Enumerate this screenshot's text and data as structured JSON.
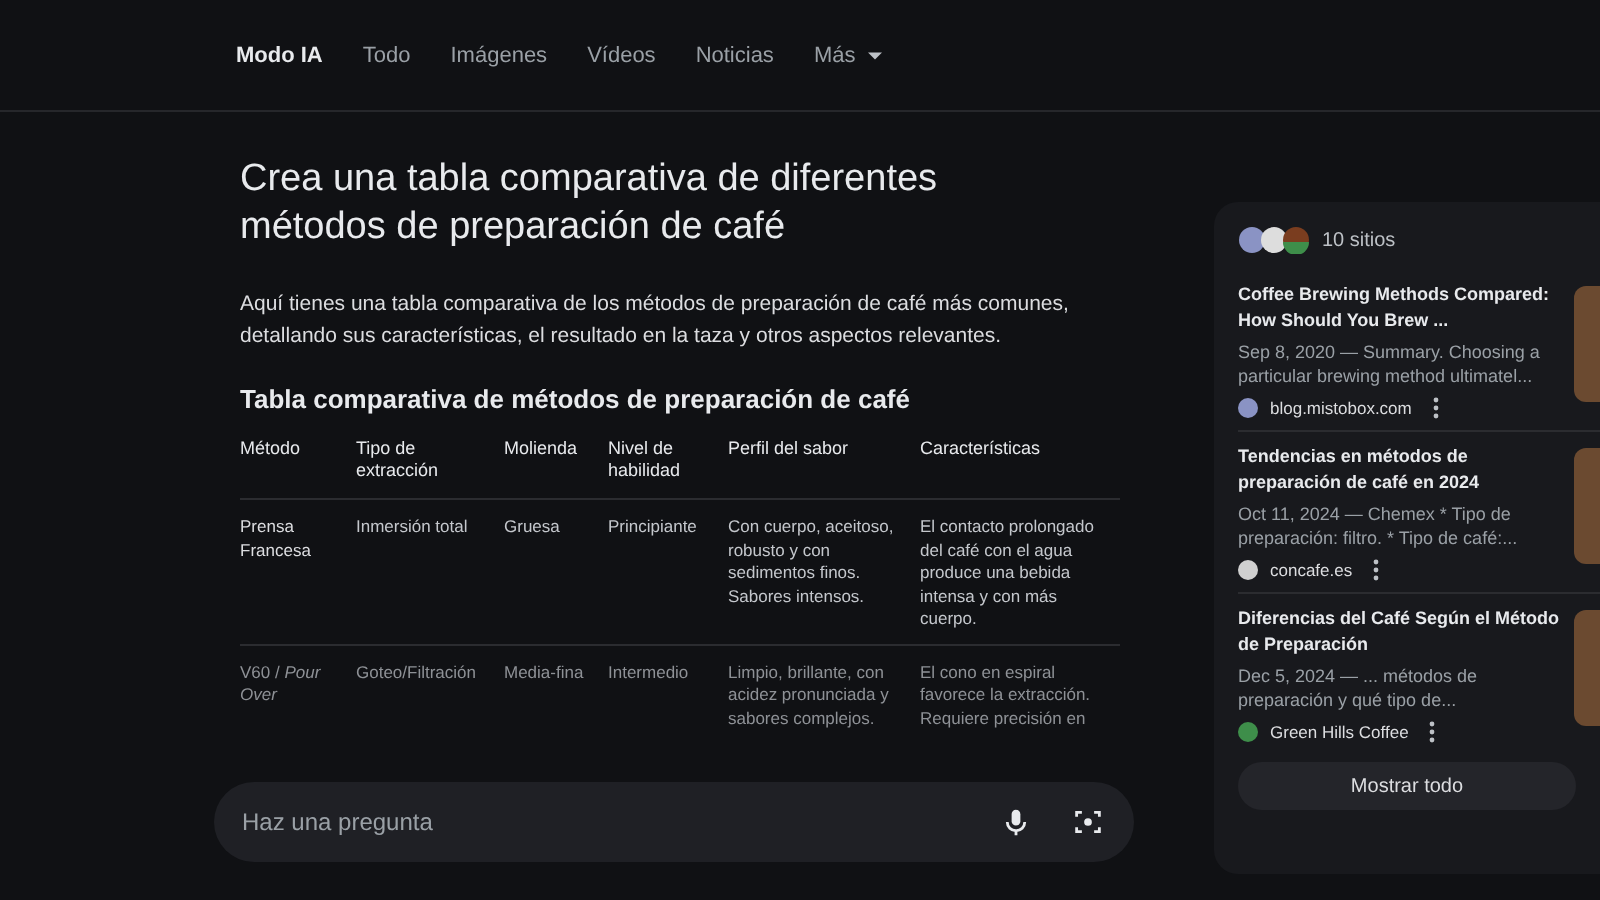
{
  "nav": {
    "tabs": [
      {
        "label": "Modo IA",
        "selected": true
      },
      {
        "label": "Todo",
        "selected": false
      },
      {
        "label": "Imágenes",
        "selected": false
      },
      {
        "label": "Vídeos",
        "selected": false
      },
      {
        "label": "Noticias",
        "selected": false
      },
      {
        "label": "Más",
        "selected": false,
        "kind": "dropdown"
      }
    ]
  },
  "answer": {
    "title": "Crea una tabla comparativa de diferentes métodos de preparación de café",
    "intro": "Aquí tienes una tabla comparativa de los métodos de preparación de café más comunes, detallando sus características, el resultado en la taza y otros aspectos relevantes.",
    "table_title": "Tabla comparativa de métodos de preparación de café",
    "table": {
      "columns": [
        "Método",
        "Tipo de extracción",
        "Molienda",
        "Nivel de habilidad",
        "Perfil del sabor",
        "Características"
      ],
      "rows": [
        [
          "Prensa Francesa",
          "Inmersión total",
          "Gruesa",
          "Principiante",
          "Con cuerpo, aceitoso, robusto y con sedimentos finos. Sabores intensos.",
          "El contacto prolongado del café con el agua produce una bebida intensa y con más cuerpo."
        ],
        [
          "V60 / *Pour Over*",
          "Goteo/Filtración",
          "Media-fina",
          "Intermedio",
          "Limpio, brillante, con acidez pronunciada y sabores complejos.",
          "El cono en espiral favorece la extracción. Requiere precisión en"
        ]
      ]
    }
  },
  "ask": {
    "placeholder": "Haz una pregunta"
  },
  "sources": {
    "count": "10 sitios",
    "items": [
      {
        "title": "Coffee Brewing Methods Compared: How Should You Brew ...",
        "snippet": "Sep 8, 2020 — Summary. Choosing a particular brewing method ultimatel...",
        "site": "blog.mistobox.com",
        "color": "#8a93c4"
      },
      {
        "title": "Tendencias en métodos de preparación de café en 2024",
        "snippet": "Oct 11, 2024 — Chemex * Tipo de preparación: filtro. * Tipo de café:...",
        "site": "concafe.es",
        "color": "#d0d0d0"
      },
      {
        "title": "Diferencias del Café Según el Método de Preparación",
        "snippet": "Dec 5, 2024 — ... métodos de preparación y qué tipo de...",
        "site": "Green Hills Coffee",
        "color": "#3e8e4a"
      }
    ],
    "show_all": "Mostrar todo"
  }
}
